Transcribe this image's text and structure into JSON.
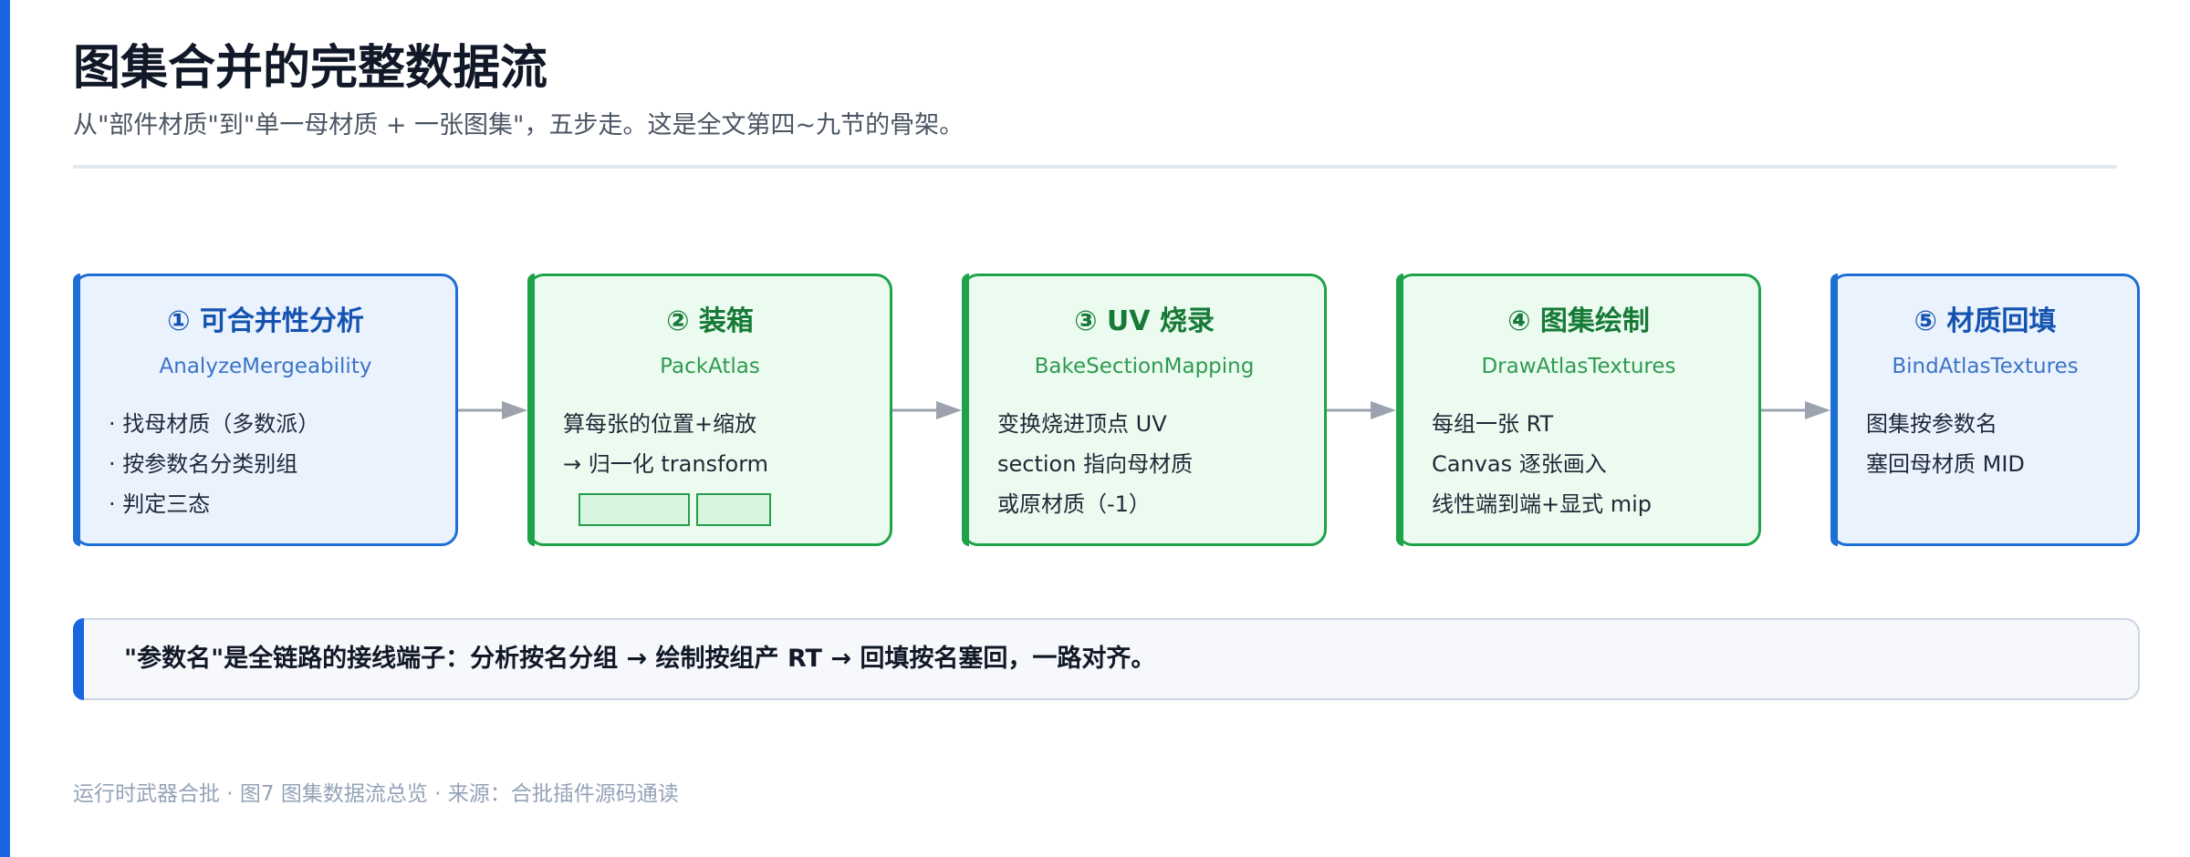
{
  "header": {
    "title": "图集合并的完整数据流",
    "subtitle": "从\"部件材质\"到\"单一母材质 + 一张图集\"，五步走。这是全文第四~九节的骨架。"
  },
  "steps": [
    {
      "title": "① 可合并性分析",
      "subtitle": "AnalyzeMergeability",
      "lines": [
        "· 找母材质（多数派）",
        "· 按参数名分类别组",
        "· 判定三态"
      ],
      "color": "blue"
    },
    {
      "title": "② 装箱",
      "subtitle": "PackAtlas",
      "lines": [
        "算每张的位置+缩放",
        "→ 归一化 transform"
      ],
      "color": "green"
    },
    {
      "title": "③ UV 烧录",
      "subtitle": "BakeSectionMapping",
      "lines": [
        "变换烧进顶点 UV",
        "section 指向母材质",
        "或原材质（-1）"
      ],
      "color": "green"
    },
    {
      "title": "④ 图集绘制",
      "subtitle": "DrawAtlasTextures",
      "lines": [
        "每组一张 RT",
        "Canvas 逐张画入",
        "线性端到端+显式 mip"
      ],
      "color": "green"
    },
    {
      "title": "⑤ 材质回填",
      "subtitle": "BindAtlasTextures",
      "lines": [
        "图集按参数名",
        "塞回母材质 MID"
      ],
      "color": "blue"
    }
  ],
  "callout": {
    "text": "\"参数名\"是全链路的接线端子：分析按名分组 → 绘制按组产 RT → 回填按名塞回，一路对齐。"
  },
  "footer": {
    "text": "运行时武器合批 · 图7 图集数据流总览 · 来源：合批插件源码通读"
  },
  "colors": {
    "accent_blue": "#1a66e0",
    "step_blue": "#1d6fd6",
    "step_green": "#1ea34a",
    "arrow_gray": "#9ca3af"
  }
}
